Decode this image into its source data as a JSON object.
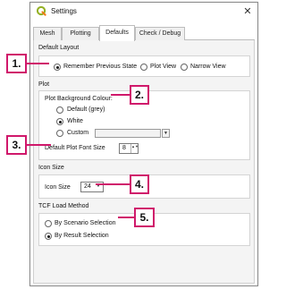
{
  "window": {
    "title": "Settings",
    "close_glyph": "✕",
    "logo_icon": "qgis-logo-icon"
  },
  "tabs": [
    {
      "label": "Mesh",
      "active": false
    },
    {
      "label": "Plotting",
      "active": false
    },
    {
      "label": "Defaults",
      "active": true
    },
    {
      "label": "Check / Debug",
      "active": false
    }
  ],
  "default_layout": {
    "title": "Default Layout",
    "options": [
      {
        "label": "Remember Previous State",
        "checked": true
      },
      {
        "label": "Plot View",
        "checked": false
      },
      {
        "label": "Narrow View",
        "checked": false
      }
    ]
  },
  "plot": {
    "title": "Plot",
    "background_label": "Plot Background Colour:",
    "options": [
      {
        "label": "Default (grey)",
        "checked": false
      },
      {
        "label": "White",
        "checked": true
      },
      {
        "label": "Custom",
        "checked": false
      }
    ],
    "font_size_label": "Default Plot Font Size",
    "font_size_value": "8",
    "spin_arrows": "▲▼"
  },
  "icon_size": {
    "title": "Icon Size",
    "label": "Icon Size",
    "value": "24",
    "arrow": "▼"
  },
  "tcf_load": {
    "title": "TCF Load Method",
    "options": [
      {
        "label": "By Scenario Selection",
        "checked": false
      },
      {
        "label": "By Result Selection",
        "checked": true
      }
    ]
  },
  "callouts": [
    "1.",
    "2.",
    "3.",
    "4.",
    "5."
  ],
  "colors": {
    "callout_border": "#d0186b",
    "qgis_green": "#93b023",
    "qgis_yellow": "#ee7913"
  }
}
